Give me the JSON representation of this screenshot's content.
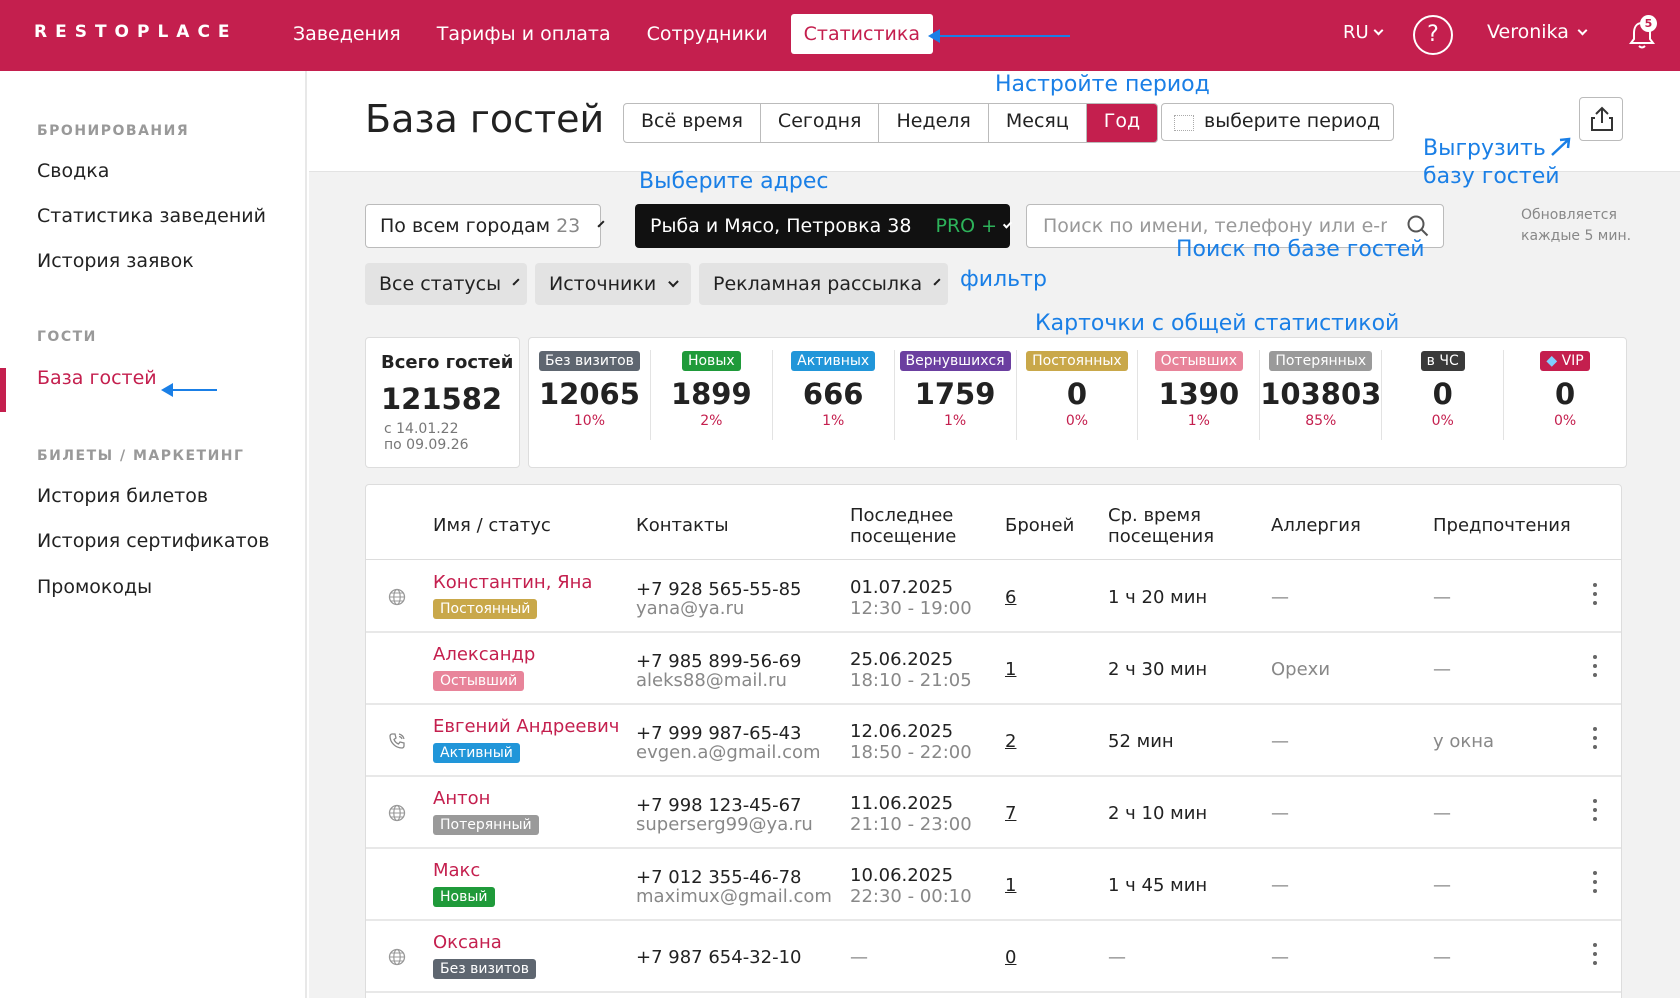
{
  "topbar": {
    "logo": "RESTOPLACE",
    "nav": [
      "Заведения",
      "Тарифы и оплата",
      "Сотрудники",
      "Статистика"
    ],
    "active_nav": "Статистика",
    "lang": "RU",
    "help": "?",
    "user": "Veronika",
    "notifications": "5",
    "bg_color": "#c41f4e"
  },
  "sidebar": {
    "sections": [
      {
        "title": "БРОНИРОВАНИЯ",
        "items": [
          "Сводка",
          "Статистика заведений",
          "История заявок"
        ]
      },
      {
        "title": "ГОСТИ",
        "items": [
          "База гостей"
        ]
      },
      {
        "title": "БИЛЕТЫ / МАРКЕТИНГ",
        "items": [
          "История билетов",
          "История сертификатов",
          "Промокоды"
        ]
      }
    ],
    "active_item": "База гостей"
  },
  "header": {
    "title": "База гостей",
    "periods": [
      "Всё время",
      "Сегодня",
      "Неделя",
      "Месяц",
      "Год"
    ],
    "active_period": "Год",
    "period_picker": "выберите период",
    "update_note_1": "Обновляется",
    "update_note_2": "каждые 5 мин."
  },
  "annotations": {
    "period": "Настройте период",
    "export_1": "Выгрузить",
    "export_2": "базу гостей",
    "address": "Выберите адрес",
    "filter": "фильтр",
    "search": "Поиск по базе гостей",
    "cards": "Карточки с общей статистикой",
    "color": "#1a7fe6"
  },
  "filters": {
    "city": "По всем городам",
    "city_count": "23",
    "place": "Рыба и Мясо, Петровка 38",
    "place_plan": "PRO +",
    "search_placeholder": "Поиск по имени, телефону или e-mail",
    "status": "Все статусы",
    "sources": "Источники",
    "mailing": "Рекламная рассылка"
  },
  "totals": {
    "label": "Всего гостей",
    "value": "121582",
    "from": "с 14.01.22",
    "to": "по 09.09.26"
  },
  "stats": [
    {
      "label": "Без визитов",
      "value": "12065",
      "pct": "10%",
      "color": "#5e6670"
    },
    {
      "label": "Новых",
      "value": "1899",
      "pct": "2%",
      "color": "#1f9a3a"
    },
    {
      "label": "Активных",
      "value": "666",
      "pct": "1%",
      "color": "#2196d9"
    },
    {
      "label": "Вернувшихся",
      "value": "1759",
      "pct": "1%",
      "color": "#6b3fa0"
    },
    {
      "label": "Постоянных",
      "value": "0",
      "pct": "0%",
      "color": "#c9a84a"
    },
    {
      "label": "Остывших",
      "value": "1390",
      "pct": "1%",
      "color": "#e8849a"
    },
    {
      "label": "Потерянных",
      "value": "103803",
      "pct": "85%",
      "color": "#9a9a9a"
    },
    {
      "label": "в ЧС",
      "value": "0",
      "pct": "0%",
      "color": "#3a3a3a"
    },
    {
      "label": "VIP",
      "value": "0",
      "pct": "0%",
      "color": "#c41f4e"
    }
  ],
  "table": {
    "headers": {
      "name": "Имя / статус",
      "contacts": "Контакты",
      "last_visit_1": "Последнее",
      "last_visit_2": "посещение",
      "bookings": "Броней",
      "avg_1": "Ср. время",
      "avg_2": "посещения",
      "allergy": "Аллергия",
      "prefs": "Предпочтения"
    },
    "rows": [
      {
        "icon": "globe",
        "name": "Константин, Яна",
        "status": "Постоянный",
        "status_color": "#c9a84a",
        "phone": "+7 928 565-55-85",
        "email": "yana@ya.ru",
        "date": "01.07.2025",
        "time": "12:30 - 19:00",
        "bookings": "6",
        "avg": "1 ч 20 мин",
        "allergy": "—",
        "prefs": "—"
      },
      {
        "icon": "",
        "name": "Александр",
        "status": "Остывший",
        "status_color": "#e8849a",
        "phone": "+7 985 899-56-69",
        "email": "aleks88@mail.ru",
        "date": "25.06.2025",
        "time": "18:10 - 21:05",
        "bookings": "1",
        "avg": "2 ч 30 мин",
        "allergy": "Орехи",
        "prefs": "—"
      },
      {
        "icon": "phone",
        "name": "Евгений Андреевич",
        "status": "Активный",
        "status_color": "#2196d9",
        "phone": "+7 999 987-65-43",
        "email": "evgen.a@gmail.com",
        "date": "12.06.2025",
        "time": "18:50 - 22:00",
        "bookings": "2",
        "avg": "52 мин",
        "allergy": "—",
        "prefs": "у окна"
      },
      {
        "icon": "globe",
        "name": "Антон",
        "status": "Потерянный",
        "status_color": "#9a9a9a",
        "phone": "+7 998 123-45-67",
        "email": "superserg99@ya.ru",
        "date": "11.06.2025",
        "time": "21:10 - 23:00",
        "bookings": "7",
        "avg": "2 ч 10 мин",
        "allergy": "—",
        "prefs": "—"
      },
      {
        "icon": "",
        "name": "Макс",
        "status": "Новый",
        "status_color": "#1f9a3a",
        "phone": "+7 012 355-46-78",
        "email": "maximux@gmail.com",
        "date": "10.06.2025",
        "time": "22:30 - 00:10",
        "bookings": "1",
        "avg": "1 ч 45 мин",
        "allergy": "—",
        "prefs": "—"
      },
      {
        "icon": "globe",
        "name": "Оксана",
        "status": "Без визитов",
        "status_color": "#5e6670",
        "phone": "+7 987 654-32-10",
        "email": "",
        "date": "—",
        "time": "",
        "bookings": "0",
        "avg": "—",
        "allergy": "—",
        "prefs": "—"
      }
    ]
  }
}
